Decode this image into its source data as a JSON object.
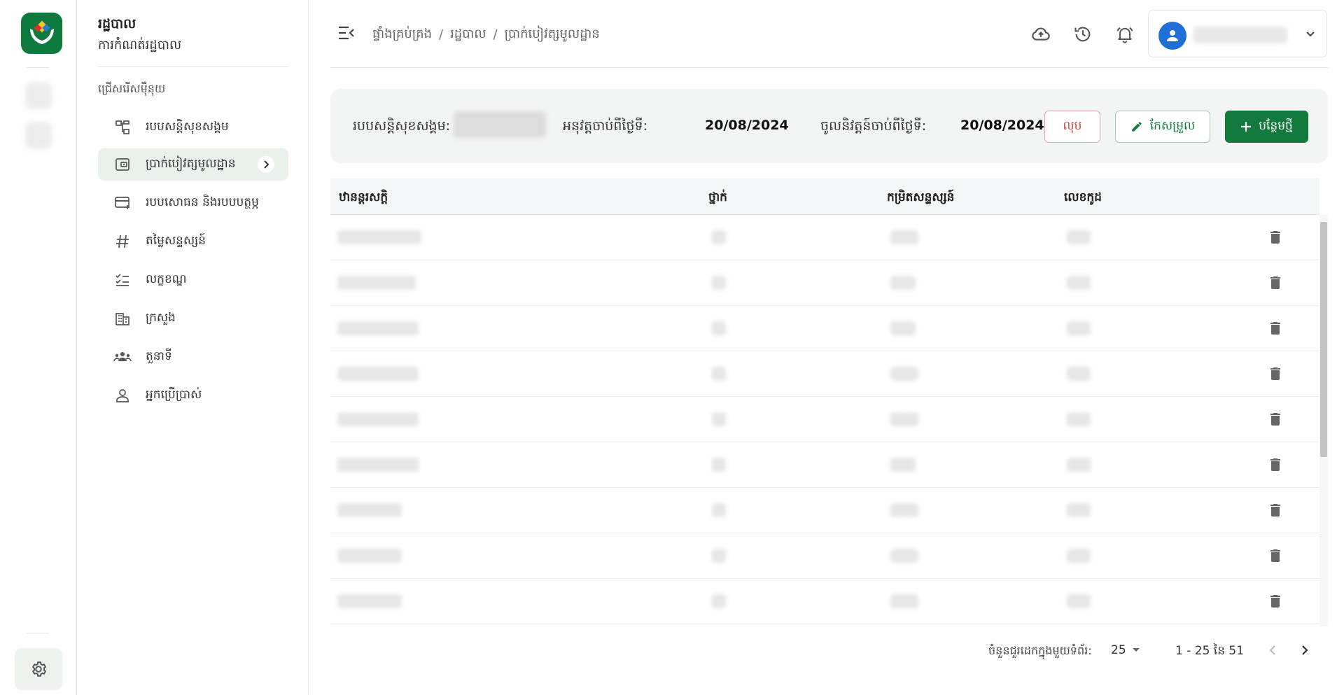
{
  "sidebar": {
    "title": "រដ្ឋបាល",
    "subtitle": "ការកំណត់រដ្ឋបាល",
    "section": "ជ្រើសរើសម៉ឺនុយ",
    "items": [
      {
        "label": "របបសន្តិសុខសង្គម",
        "icon": "hierarchy-icon"
      },
      {
        "label": "ប្រាក់បៀវត្សមូលដ្ឋាន",
        "icon": "wallet-icon",
        "active": true
      },
      {
        "label": "របបសោធន និងរបបបត្ថម្ភ",
        "icon": "card-add-icon"
      },
      {
        "label": "តម្លៃសន្ទស្សន៍",
        "icon": "hash-icon"
      },
      {
        "label": "លក្ខខណ្ឌ",
        "icon": "checklist-icon"
      },
      {
        "label": "ក្រសួង",
        "icon": "building-icon"
      },
      {
        "label": "តួនាទី",
        "icon": "group-icon"
      },
      {
        "label": "អ្នកប្រើប្រាស់",
        "icon": "person-icon"
      }
    ]
  },
  "header": {
    "breadcrumb": [
      "ផ្ទាំងគ្រប់គ្រង",
      "រដ្ឋបាល",
      "ប្រាក់បៀវត្សមូលដ្ឋាន"
    ],
    "separator": "/"
  },
  "info": {
    "scheme_label": "របបសន្តិសុខសង្គម:",
    "effective_label": "អនុវត្តចាប់ពីថ្ងៃទី:",
    "effective_date": "20/08/2024",
    "inforce_label": "ចូលនិវត្តន៍ចាប់ពីថ្ងៃទី:",
    "inforce_date": "20/08/2024",
    "delete_label": "លុប",
    "edit_label": "កែសម្រួល",
    "add_label": "បន្ថែមថ្មី"
  },
  "table": {
    "columns": [
      "ឋានន្តរសក្តិ",
      "ថ្នាក់",
      "កម្រិតសន្ទស្សន៍",
      "លេខកូដ"
    ]
  },
  "paginator": {
    "page_size_label": "ចំនួនជួរដេកក្នុងមួយទំព័រ:",
    "page_size": "25",
    "range": "1 - 25 នៃ 51"
  },
  "colors": {
    "primary": "#137a3d",
    "danger": "#d0453f",
    "avatar": "#1e6fd9"
  }
}
